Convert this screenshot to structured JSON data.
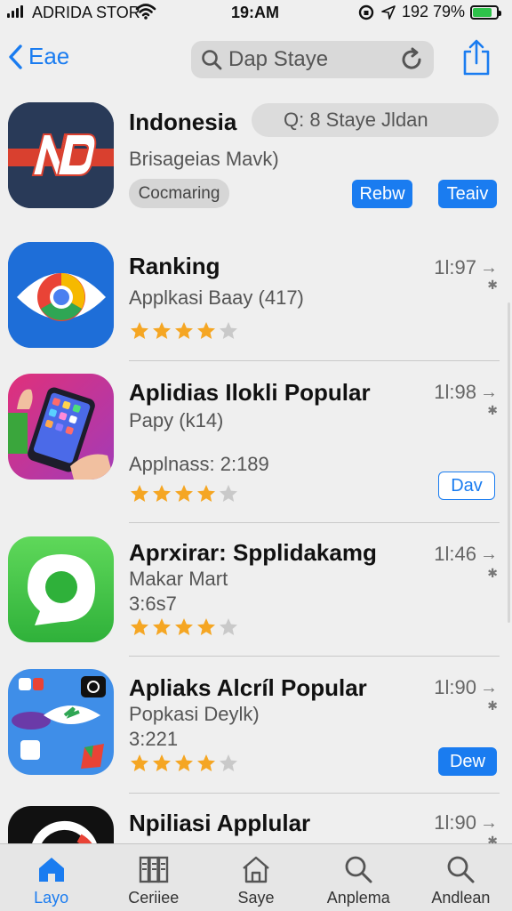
{
  "status": {
    "carrier": "ADRIDA STOR",
    "time": "19:AM",
    "right_text": "192 79%",
    "battery_level": 0.79
  },
  "nav": {
    "back_label": "Eae",
    "search_text": "Dap Staye"
  },
  "apps": [
    {
      "title": "Indonesia",
      "subtitle": "Brisageias Mavk)",
      "search_text": "Q: 8 Staye Jldan",
      "tag": "Cocmaring",
      "button_left": "Rebw",
      "button_right": "Teaiv"
    },
    {
      "title": "Ranking",
      "subtitle": "Applkasi Baay (417)",
      "time": "1l:97",
      "rating": 4
    },
    {
      "title": "Aplidias Ilokli Popular",
      "subtitle": "Papy (k14)",
      "extra": "Applnass: 2:189",
      "time": "1l:98",
      "rating": 4,
      "button": "Dav"
    },
    {
      "title": "Aprxirar: Spplidakamg",
      "subtitle": "Makar Mart",
      "extra": "3:6s7",
      "time": "1l:46",
      "rating": 4
    },
    {
      "title": "Apliaks Alcríl Popular",
      "subtitle": "Popkasi Deylk)",
      "extra": "3:221",
      "time": "1l:90",
      "rating": 4,
      "button": "Dew"
    },
    {
      "title": "Npiliasi Applular",
      "time": "1l:90"
    }
  ],
  "tabs": [
    {
      "label": "Layo",
      "icon": "home-icon",
      "active": true
    },
    {
      "label": "Ceriiee",
      "icon": "library-icon"
    },
    {
      "label": "Saye",
      "icon": "house-outline-icon"
    },
    {
      "label": "Anplema",
      "icon": "search-icon"
    },
    {
      "label": "Andlean",
      "icon": "search-icon"
    }
  ],
  "colors": {
    "accent": "#1a7cf0",
    "star": "#f5a623",
    "battery": "#2ec24a"
  }
}
